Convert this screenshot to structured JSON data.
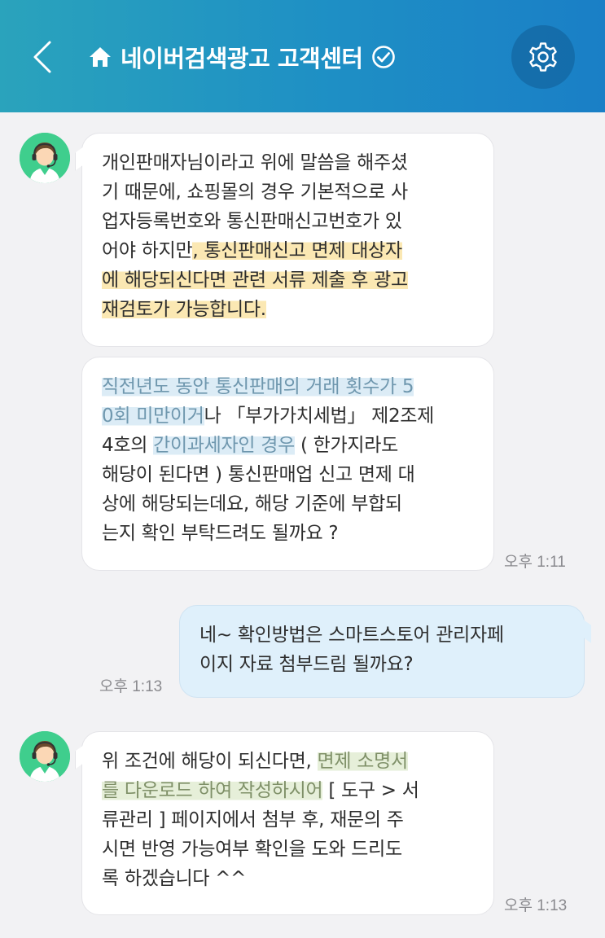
{
  "header": {
    "title": "네이버검색광고 고객센터",
    "back_icon": "chevron-left-icon",
    "home_icon": "home-icon",
    "verified_icon": "check-circle-icon",
    "settings_icon": "gear-icon",
    "colors": {
      "gradient_start": "#2aa3bc",
      "gradient_end": "#1a7fc6"
    }
  },
  "messages": [
    {
      "sender": "agent",
      "lines": [
        [
          {
            "text": "개인판매자님이라고 위에 말씀을 해주셨"
          }
        ],
        [
          {
            "text": "기 때문에, 쇼핑몰의 경우 기본적으로 사"
          }
        ],
        [
          {
            "text": "업자등록번호와 통신판매신고번호가 있"
          }
        ],
        [
          {
            "text": "어야 하지만"
          },
          {
            "text": ", 통신판매신고 면제 대상자",
            "hl": "yellow"
          }
        ],
        [
          {
            "text": "에 해당되신다면 관련 서류 제출 후 광고",
            "hl": "yellow"
          }
        ],
        [
          {
            "text": "재검토가 가능합니다.",
            "hl": "yellow"
          }
        ]
      ]
    },
    {
      "sender": "agent",
      "lines": [
        [
          {
            "text": "직전년도 동안 통신판매의 거래 횟수가 5",
            "hl": "blue"
          }
        ],
        [
          {
            "text": "0회 미만이거",
            "hl": "blue"
          },
          {
            "text": "나 「부가가치세법」 제2조제"
          }
        ],
        [
          {
            "text": "4호의 "
          },
          {
            "text": "간이과세자인 경우",
            "hl": "blue"
          },
          {
            "text": " ( 한가지라도"
          }
        ],
        [
          {
            "text": "해당이 된다면 ) 통신판매업 신고 면제 대"
          }
        ],
        [
          {
            "text": "상에 해당되는데요, 해당 기준에 부합되"
          }
        ],
        [
          {
            "text": "는지 확인 부탁드려도 될까요 ?"
          }
        ]
      ],
      "time": "오후 1:11"
    },
    {
      "sender": "me",
      "lines": [
        [
          {
            "text": "네~ 확인방법은 스마트스토어 관리자페"
          }
        ],
        [
          {
            "text": "이지 자료 첨부드림 될까요?"
          }
        ]
      ],
      "time": "오후 1:13"
    },
    {
      "sender": "agent",
      "lines": [
        [
          {
            "text": "위 조건에 해당이 되신다면, "
          },
          {
            "text": "면제 소명서",
            "hl": "green"
          }
        ],
        [
          {
            "text": "를 다운로드 하여 작성하시어",
            "hl": "green"
          },
          {
            "text": " [ 도구 > 서"
          }
        ],
        [
          {
            "text": "류관리 ] 페이지에서 첨부 후, 재문의 주"
          }
        ],
        [
          {
            "text": "시면 반영 가능여부 확인을 도와 드리도"
          }
        ],
        [
          {
            "text": "록 하겠습니다 ^^"
          }
        ]
      ],
      "time": "오후 1:13"
    }
  ],
  "avatar_icon": "agent-headset-avatar-icon"
}
